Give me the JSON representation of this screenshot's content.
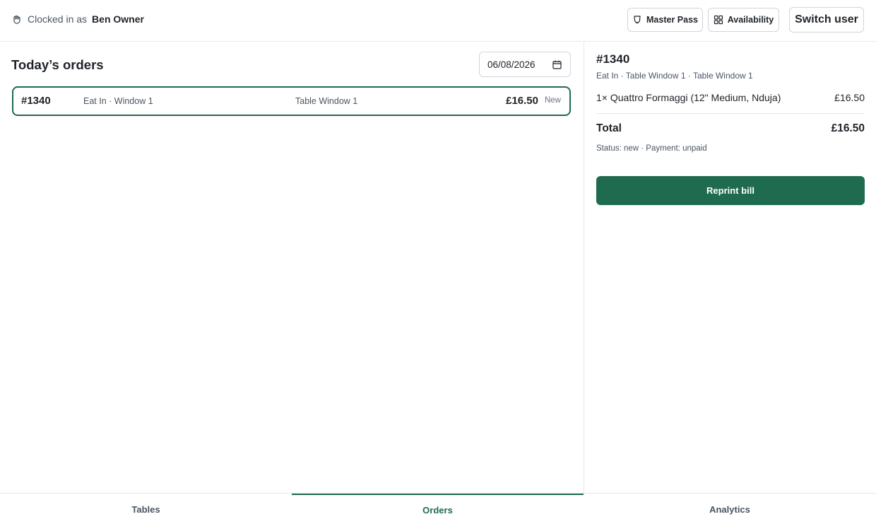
{
  "header": {
    "clocked_label": "Clocked in as",
    "user_name": "Ben Owner",
    "master_pass_label": "Master Pass",
    "availability_label": "Availability",
    "switch_user_label": "Switch user"
  },
  "orders": {
    "title": "Today’s orders",
    "date_value": "06/08/2026",
    "rows": [
      {
        "id": "#1340",
        "type": "Eat In · Window 1",
        "table": "Table Window 1",
        "total": "£16.50",
        "status": "New"
      }
    ]
  },
  "detail": {
    "id": "#1340",
    "subtitle": "Eat In · Table Window 1 · Table Window 1",
    "items": [
      {
        "desc": "1× Quattro Formaggi (12\" Medium, Nduja)",
        "price": "£16.50"
      }
    ],
    "total_label": "Total",
    "total_value": "£16.50",
    "status_line": "Status: new · Payment: unpaid",
    "reprint_label": "Reprint bill"
  },
  "nav": {
    "tables": "Tables",
    "orders": "Orders",
    "analytics": "Analytics"
  },
  "colors": {
    "accent": "#1f6b50"
  },
  "icons": {
    "clock": "hand-icon",
    "master_pass": "shield-icon",
    "availability": "grid-icon",
    "date": "calendar-icon"
  }
}
